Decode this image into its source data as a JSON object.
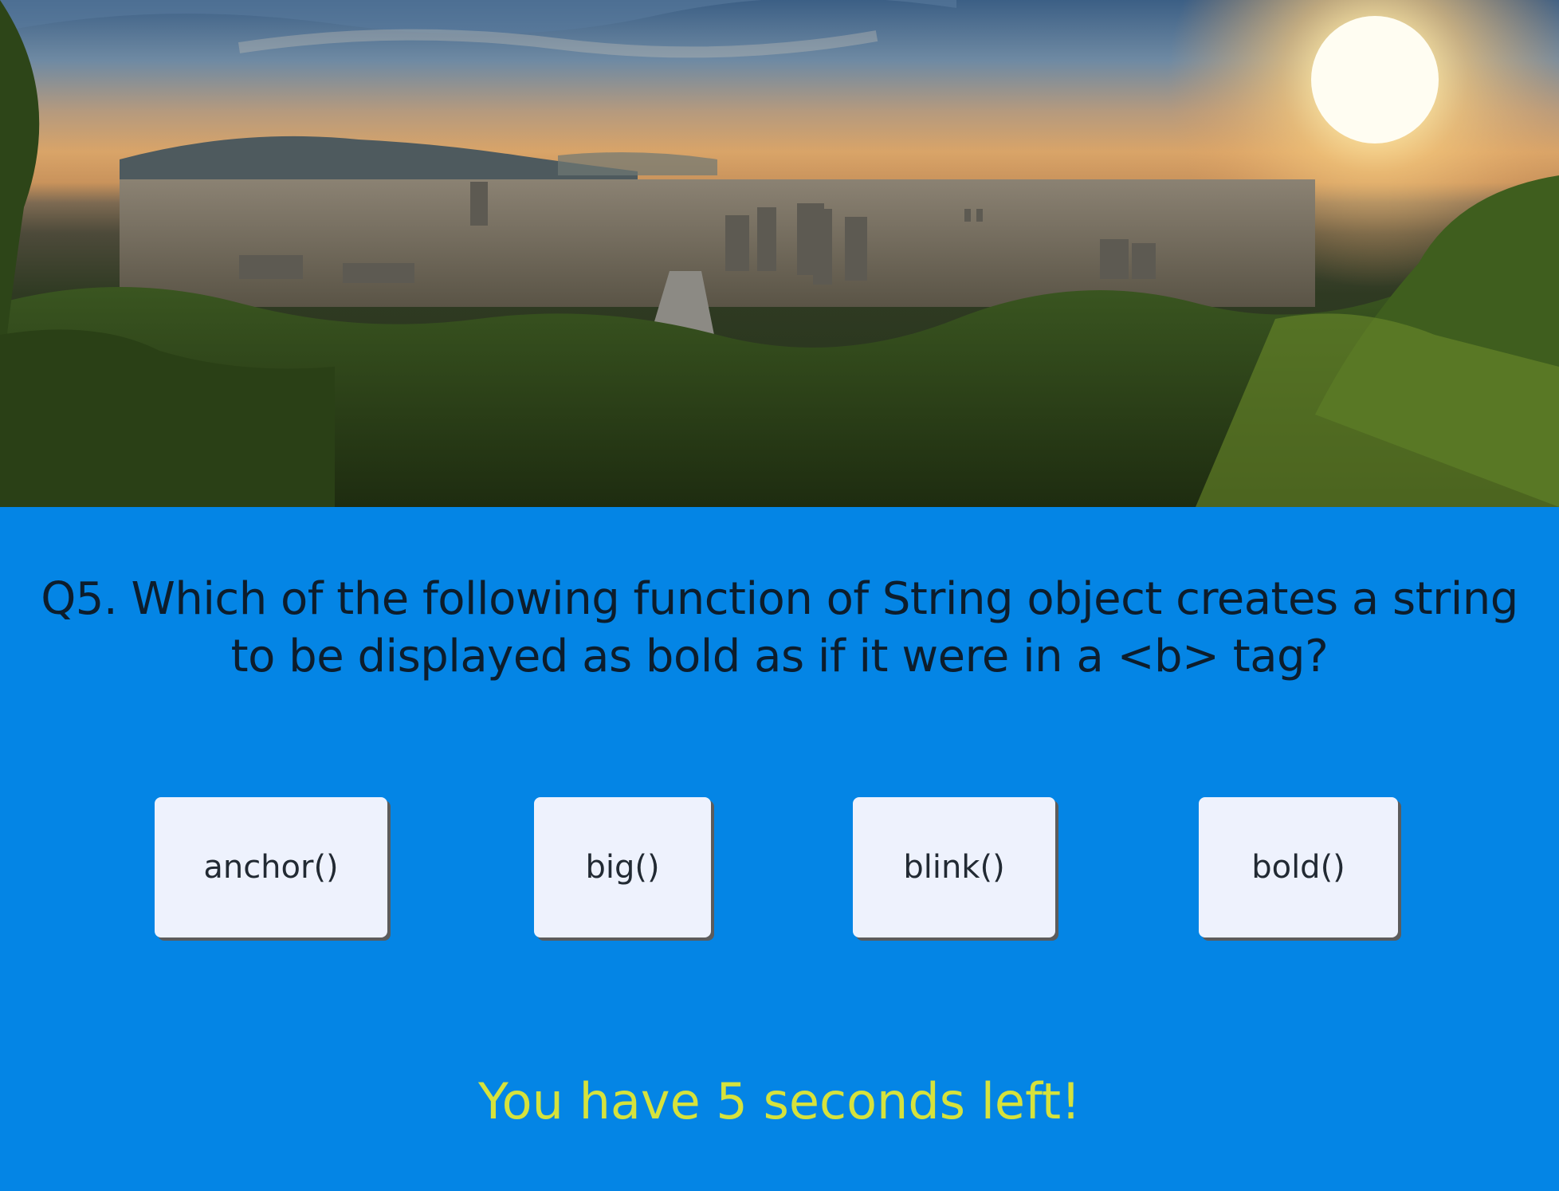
{
  "hero": {
    "image_name": "city-landscape-sunset-image"
  },
  "question": {
    "line1": "Q5. Which of the following function of String object creates a string",
    "line2": "to be displayed as bold as if it were in a <b> tag?"
  },
  "answers": [
    {
      "label": "anchor()"
    },
    {
      "label": "big()"
    },
    {
      "label": "blink()"
    },
    {
      "label": "bold()"
    }
  ],
  "timer": {
    "text": "You have 5 seconds left!"
  },
  "colors": {
    "background": "#0485e5",
    "button_bg": "#eef2fd",
    "timer_text": "#d6e23c",
    "question_text": "#0d1d2c"
  }
}
